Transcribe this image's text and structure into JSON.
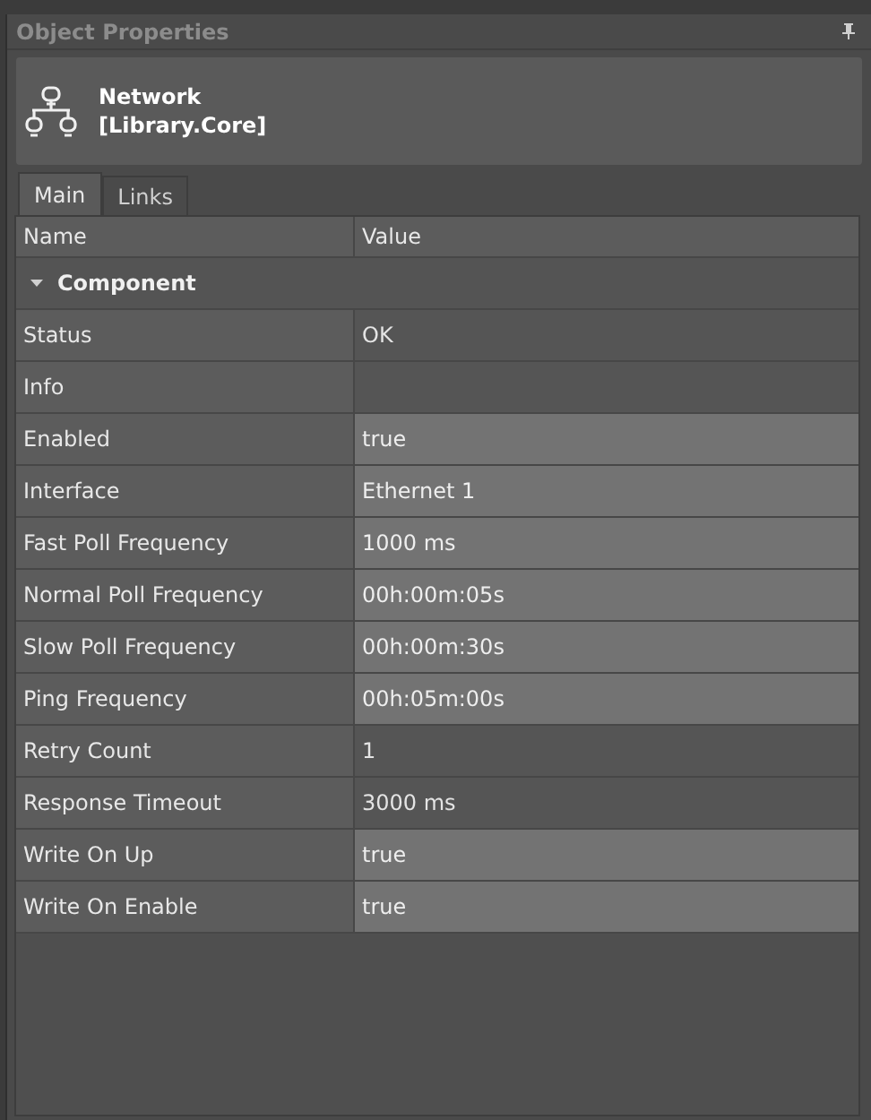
{
  "panel": {
    "title": "Object Properties"
  },
  "object": {
    "name": "Network",
    "library": "[Library.Core]"
  },
  "tabs": [
    {
      "label": "Main",
      "selected": true
    },
    {
      "label": "Links",
      "selected": false
    }
  ],
  "grid": {
    "columns": [
      "Name",
      "Value"
    ],
    "group": {
      "label": "Component",
      "expanded": true
    },
    "rows": [
      {
        "name": "Status",
        "value": "OK",
        "editable": false
      },
      {
        "name": "Info",
        "value": "",
        "editable": false
      },
      {
        "name": "Enabled",
        "value": "true",
        "editable": true
      },
      {
        "name": "Interface",
        "value": "Ethernet 1",
        "editable": true
      },
      {
        "name": "Fast Poll Frequency",
        "value": "1000 ms",
        "editable": true
      },
      {
        "name": "Normal Poll Frequency",
        "value": "00h:00m:05s",
        "editable": true
      },
      {
        "name": "Slow Poll Frequency",
        "value": "00h:00m:30s",
        "editable": true
      },
      {
        "name": "Ping Frequency",
        "value": "00h:05m:00s",
        "editable": true
      },
      {
        "name": "Retry Count",
        "value": "1",
        "editable": false
      },
      {
        "name": "Response Timeout",
        "value": "3000 ms",
        "editable": false
      },
      {
        "name": "Write On Up",
        "value": "true",
        "editable": true
      },
      {
        "name": "Write On Enable",
        "value": "true",
        "editable": true
      }
    ]
  }
}
